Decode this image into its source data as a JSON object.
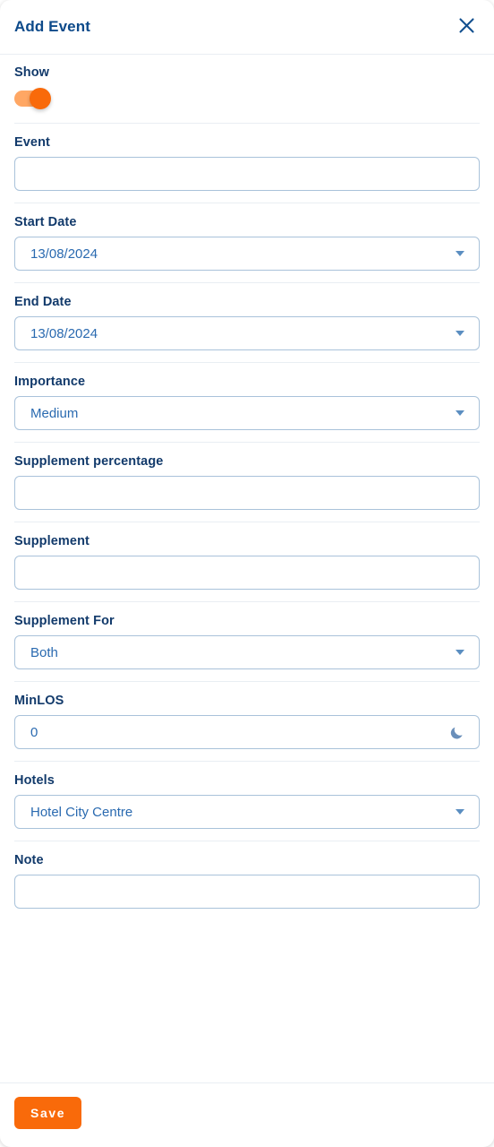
{
  "header": {
    "title": "Add Event",
    "close_icon": "close-icon"
  },
  "fields": {
    "show": {
      "label": "Show",
      "enabled": true
    },
    "event": {
      "label": "Event",
      "value": "",
      "placeholder": ""
    },
    "start_date": {
      "label": "Start Date",
      "value": "13/08/2024",
      "icon": "chevron-down-icon"
    },
    "end_date": {
      "label": "End Date",
      "value": "13/08/2024",
      "icon": "chevron-down-icon"
    },
    "importance": {
      "label": "Importance",
      "value": "Medium",
      "icon": "chevron-down-icon"
    },
    "supplement_percentage": {
      "label": "Supplement percentage",
      "value": "",
      "placeholder": ""
    },
    "supplement": {
      "label": "Supplement",
      "value": "",
      "placeholder": ""
    },
    "supplement_for": {
      "label": "Supplement For",
      "value": "Both",
      "icon": "chevron-down-icon"
    },
    "minlos": {
      "label": "MinLOS",
      "value": "0",
      "icon": "moon-icon"
    },
    "hotels": {
      "label": "Hotels",
      "value": "Hotel City Centre",
      "icon": "chevron-down-icon"
    },
    "note": {
      "label": "Note",
      "value": "",
      "placeholder": ""
    }
  },
  "footer": {
    "save_label": "Save"
  },
  "colors": {
    "accent_orange": "#f96a0a",
    "toggle_track": "#ffa764",
    "title_blue": "#0d4a8a",
    "label_blue": "#123a6b",
    "value_blue": "#2a6ab0",
    "border_blue": "#a9c2da",
    "divider": "#e9eef3",
    "icon_blue": "#5b8ec1"
  }
}
